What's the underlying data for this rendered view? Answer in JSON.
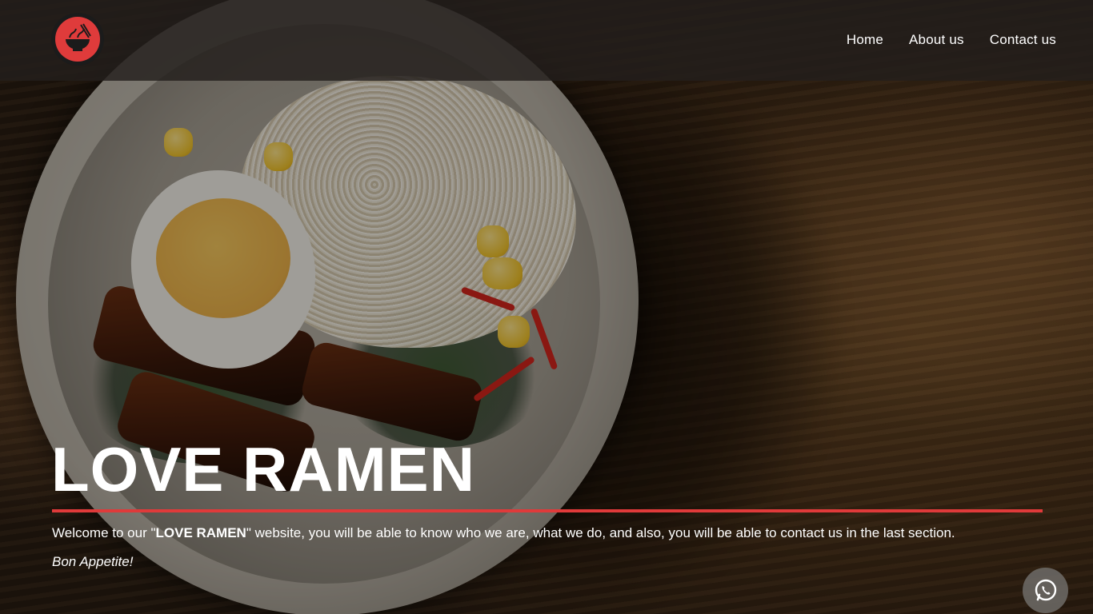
{
  "header": {
    "logo_icon": "ramen-bowl-logo-icon",
    "nav": [
      {
        "label": "Home"
      },
      {
        "label": "About us"
      },
      {
        "label": "Contact us"
      }
    ]
  },
  "hero": {
    "title": "LOVE RAMEN",
    "welcome_prefix": "Welcome to our \"",
    "welcome_brand": "LOVE RAMEN",
    "welcome_suffix": "\" website, you will be able to know who we are, what we do, and also, you will be able to contact us in the last section.",
    "signoff": "Bon Appetite!"
  },
  "floating": {
    "whatsapp_icon": "whatsapp-icon"
  },
  "colors": {
    "accent": "#e03a3a",
    "header_bg": "#231e1c",
    "text": "#ffffff"
  }
}
